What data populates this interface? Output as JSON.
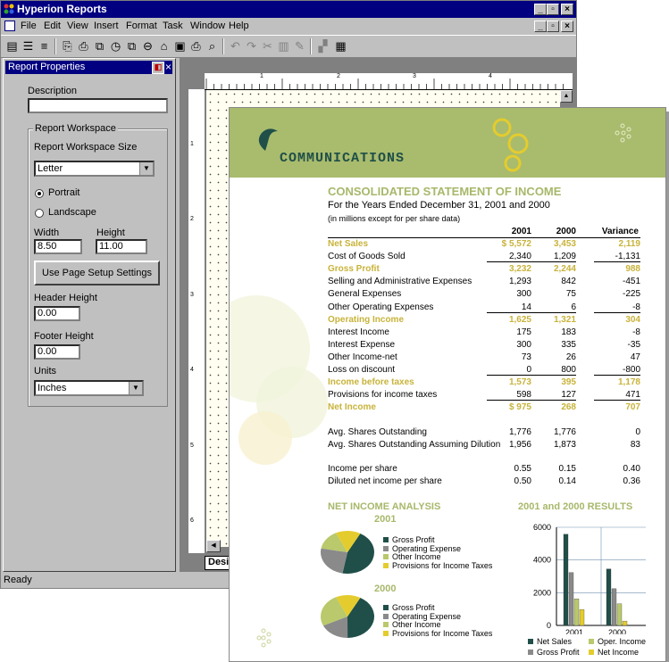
{
  "window": {
    "title": "Hyperion Reports",
    "min": "_",
    "max": "▫",
    "close": "×"
  },
  "menu": [
    "File",
    "Edit",
    "View",
    "Insert",
    "Format",
    "Task",
    "Window",
    "Help"
  ],
  "props": {
    "title": "Report Properties",
    "description_label": "Description",
    "description_value": "",
    "workspace_group": "Report Workspace",
    "size_label": "Report Workspace Size",
    "size_value": "Letter",
    "portrait": "Portrait",
    "landscape": "Landscape",
    "width_label": "Width",
    "width_value": "8.50",
    "height_label": "Height",
    "height_value": "11.00",
    "page_setup_button": "Use Page Setup Settings",
    "header_height_label": "Header Height",
    "header_height_value": "0.00",
    "footer_height_label": "Footer Height",
    "footer_height_value": "0.00",
    "units_label": "Units",
    "units_value": "Inches"
  },
  "design": {
    "tab": "Design",
    "ruler_numbers": [
      "1",
      "2",
      "3",
      "4"
    ],
    "vruler_numbers": [
      "1",
      "2",
      "3",
      "4",
      "5",
      "6"
    ]
  },
  "status": "Ready",
  "report": {
    "logo_text": "COMMUNICATIONS",
    "title": "CONSOLIDATED STATEMENT OF INCOME",
    "subtitle": "For the Years Ended December 31, 2001 and 2000",
    "note": "(in millions except for per share data)",
    "col_headers": [
      "2001",
      "2000",
      "Variance"
    ],
    "rows": [
      {
        "label": "Net Sales",
        "v": [
          "$ 5,572",
          "3,453",
          "2,119"
        ],
        "style": "gold"
      },
      {
        "label": "Cost of Goods Sold",
        "v": [
          "2,340",
          "1,209",
          "-1,131"
        ],
        "style": "uline"
      },
      {
        "label": "Gross Profit",
        "v": [
          "3,232",
          "2,244",
          "988"
        ],
        "style": "gold"
      },
      {
        "label": "Selling and Administrative Expenses",
        "v": [
          "1,293",
          "842",
          "-451"
        ],
        "style": ""
      },
      {
        "label": "General Expenses",
        "v": [
          "300",
          "75",
          "-225"
        ],
        "style": ""
      },
      {
        "label": "Other Operating Expenses",
        "v": [
          "14",
          "6",
          "-8"
        ],
        "style": "uline"
      },
      {
        "label": "Operating Income",
        "v": [
          "1,625",
          "1,321",
          "304"
        ],
        "style": "gold"
      },
      {
        "label": "Interest Income",
        "v": [
          "175",
          "183",
          "-8"
        ],
        "style": ""
      },
      {
        "label": "Interest Expense",
        "v": [
          "300",
          "335",
          "-35"
        ],
        "style": ""
      },
      {
        "label": "Other Income-net",
        "v": [
          "73",
          "26",
          "47"
        ],
        "style": ""
      },
      {
        "label": "Loss on discount",
        "v": [
          "0",
          "800",
          "-800"
        ],
        "style": "uline"
      },
      {
        "label": "Income before taxes",
        "v": [
          "1,573",
          "395",
          "1,178"
        ],
        "style": "gold"
      },
      {
        "label": "Provisions for income taxes",
        "v": [
          "598",
          "127",
          "471"
        ],
        "style": "uline"
      },
      {
        "label": "Net Income",
        "v": [
          "$ 975",
          "268",
          "707"
        ],
        "style": "gold"
      }
    ],
    "share_rows": [
      {
        "label": "Avg. Shares Outstanding",
        "v": [
          "1,776",
          "1,776",
          "0"
        ]
      },
      {
        "label": "Avg. Shares Outstanding Assuming Dilution",
        "v": [
          "1,956",
          "1,873",
          "83"
        ]
      }
    ],
    "eps_rows": [
      {
        "label": "Income per share",
        "v": [
          "0.55",
          "0.15",
          "0.40"
        ]
      },
      {
        "label": "Diluted net income per share",
        "v": [
          "0.50",
          "0.14",
          "0.36"
        ]
      }
    ],
    "pie_section_title": "NET INCOME ANALYSIS",
    "bar_section_title": "2001 and 2000 RESULTS",
    "pie_legend": [
      "Gross Profit",
      "Operating Expense",
      "Other Income",
      "Provisions for Income Taxes"
    ],
    "bar_legend": [
      "Net Sales",
      "Oper. Income",
      "Gross Profit",
      "Net Income"
    ]
  },
  "colors": {
    "dark": "#1f4f48",
    "gray": "#8a8a8a",
    "lime": "#b9c96b",
    "yellow": "#e4cc2e",
    "gold": "#c8b33a",
    "sage": "#a7b86a"
  },
  "chart_data": [
    {
      "type": "pie",
      "title": "2001",
      "categories": [
        "Gross Profit",
        "Operating Expense",
        "Other Income",
        "Provisions for Income Taxes"
      ],
      "values": [
        45,
        25,
        15,
        15
      ]
    },
    {
      "type": "pie",
      "title": "2000",
      "categories": [
        "Gross Profit",
        "Operating Expense",
        "Other Income",
        "Provisions for Income Taxes"
      ],
      "values": [
        42,
        18,
        25,
        15
      ]
    },
    {
      "type": "bar",
      "title": "2001 and 2000 RESULTS",
      "categories": [
        "2001",
        "2000"
      ],
      "ylim": [
        0,
        6000
      ],
      "yticks": [
        "0",
        "2000",
        "4000",
        "6000"
      ],
      "series": [
        {
          "name": "Net Sales",
          "values": [
            5572,
            3453
          ]
        },
        {
          "name": "Gross Profit",
          "values": [
            3232,
            2244
          ]
        },
        {
          "name": "Oper. Income",
          "values": [
            1625,
            1321
          ]
        },
        {
          "name": "Net Income",
          "values": [
            975,
            268
          ]
        }
      ]
    }
  ]
}
